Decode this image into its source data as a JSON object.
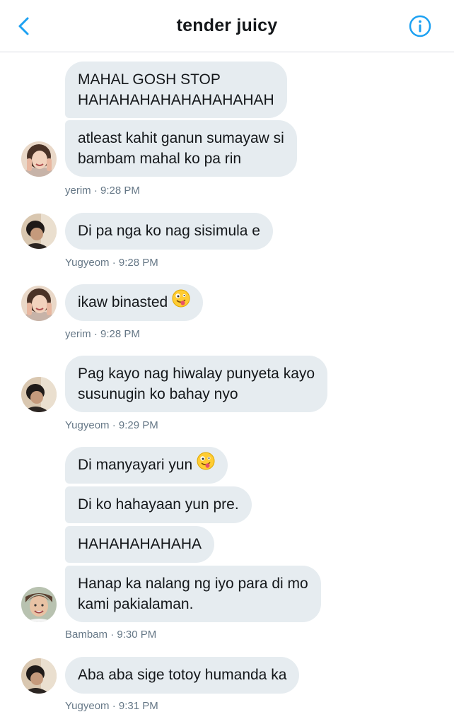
{
  "header": {
    "title": "tender juicy",
    "back_icon": "chevron-left-icon",
    "info_icon": "info-icon",
    "accent_color": "#1da1f2"
  },
  "messages": [
    {
      "text": "MAHAL GOSH STOP",
      "text2": "HAHAHAHAHAHAHAHAHAH"
    },
    {
      "text": "atleast kahit ganun sumayaw si",
      "text2": "bambam mahal ko pa rin"
    },
    {
      "text": "Di pa nga ko nag sisimula e"
    },
    {
      "text": "ikaw binasted",
      "emoji": "zany-face-icon"
    },
    {
      "text": "Pag kayo nag hiwalay punyeta kayo",
      "text2": "susunugin ko bahay nyo"
    },
    {
      "text": "Di manyayari yun",
      "emoji": "zany-face-icon"
    },
    {
      "text": "Di ko hahayaan yun pre."
    },
    {
      "text": "HAHAHAHAHAHA"
    },
    {
      "text": "Hanap ka nalang ng iyo para di mo",
      "text2": "kami pakialaman."
    },
    {
      "text": "Aba aba sige totoy humanda ka"
    }
  ],
  "meta": [
    {
      "sender": "yerim",
      "time": "9:28 PM"
    },
    {
      "sender": "Yugyeom",
      "time": "9:28 PM"
    },
    {
      "sender": "yerim",
      "time": "9:28 PM"
    },
    {
      "sender": "Yugyeom",
      "time": "9:29 PM"
    },
    {
      "sender": "Bambam",
      "time": "9:30 PM"
    },
    {
      "sender": "Yugyeom",
      "time": "9:31 PM"
    }
  ],
  "colors": {
    "bubble": "#e6ecf0",
    "meta_text": "#657786",
    "divider": "#d9dde2"
  }
}
